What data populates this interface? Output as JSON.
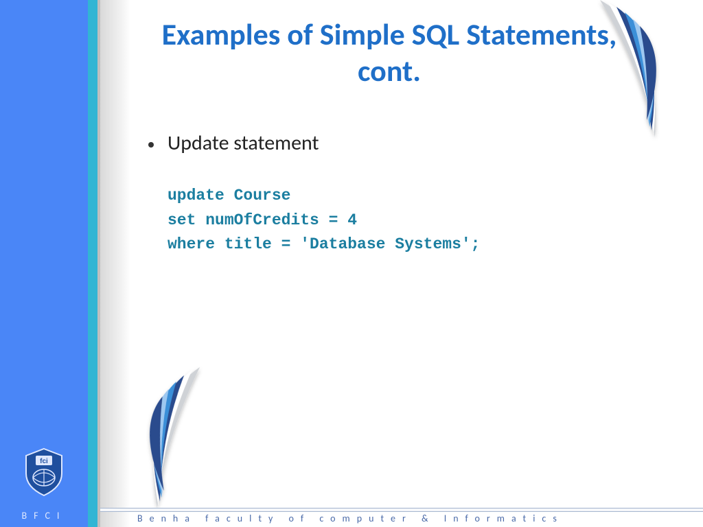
{
  "title": "Examples of Simple SQL Statements, cont.",
  "bullet": "Update statement",
  "code": "update Course\nset numOfCredits = 4\nwhere title = 'Database Systems';",
  "footer": "Benha faculty of computer & Informatics",
  "side_label": "BFCI"
}
